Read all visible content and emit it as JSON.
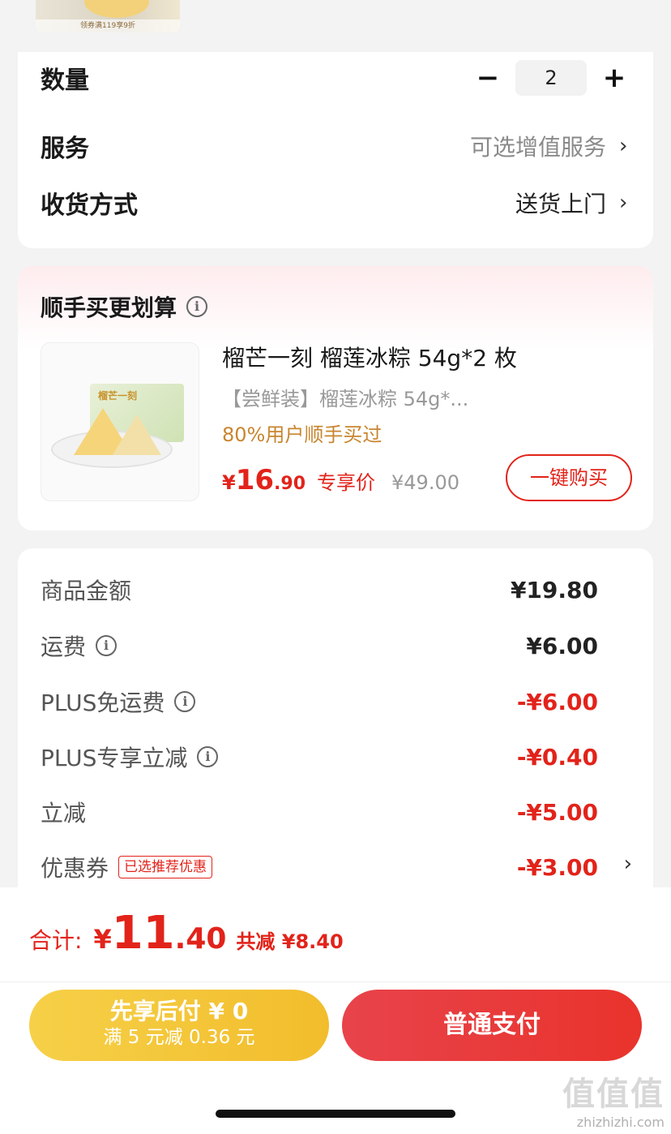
{
  "top_product": {
    "caption": "领券满119享9折"
  },
  "order_options": {
    "quantity": {
      "label": "数量",
      "minus": "−",
      "value": "2",
      "plus": "+"
    },
    "service": {
      "label": "服务",
      "value": "可选增值服务",
      "chevron": "›"
    },
    "delivery": {
      "label": "收货方式",
      "value": "送货上门",
      "chevron": "›"
    }
  },
  "addon": {
    "title": "顺手买更划算",
    "info_icon": "i",
    "product": {
      "image_text": "榴芒一刻",
      "name": "榴芒一刻 榴莲冰粽 54g*2 枚",
      "subtitle": "【尝鲜装】榴莲冰粽 54g*...",
      "tip": "80%用户顺手买过",
      "price_yen": "¥",
      "price_int": "16",
      "price_dec": ".90",
      "price_tag": "专享价",
      "original_price": "¥49.00",
      "buy_label": "一键购买"
    }
  },
  "fees": [
    {
      "label": "商品金额",
      "value": "¥19.80",
      "info": false,
      "red": false
    },
    {
      "label": "运费",
      "value": "¥6.00",
      "info": true,
      "red": false
    },
    {
      "label": "PLUS免运费",
      "value": "-¥6.00",
      "info": true,
      "red": true
    },
    {
      "label": "PLUS专享立减",
      "value": "-¥0.40",
      "info": true,
      "red": true
    },
    {
      "label": "立减",
      "value": "-¥5.00",
      "info": false,
      "red": true
    },
    {
      "label": "优惠券",
      "value": "-¥3.00",
      "tag": "已选推荐优惠",
      "chevron": "›",
      "red": true
    }
  ],
  "summary": {
    "total_label": "合计:",
    "total_yen": "¥",
    "total_int": "11",
    "total_dec": ".40",
    "saved": "共减 ¥8.40"
  },
  "actions": {
    "pay_later_line1": "先享后付 ¥ 0",
    "pay_later_line2": "满 5 元减 0.36 元",
    "pay_normal": "普通支付"
  },
  "watermark": {
    "logo": "值值值",
    "url": "zhizhizhi.com"
  },
  "colors": {
    "accent_red": "#e2231a",
    "gold": "#c8862f",
    "pay_later_yellow": "#f2bd2c"
  }
}
